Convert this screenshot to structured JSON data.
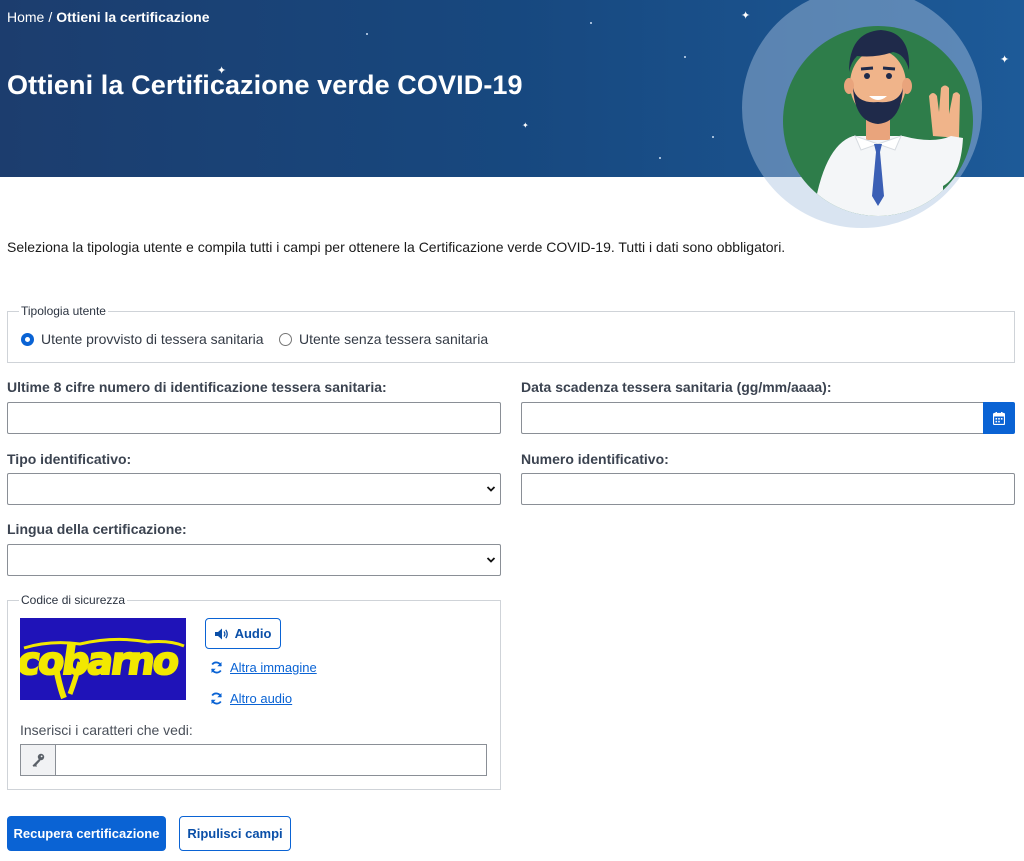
{
  "breadcrumb": {
    "home": "Home",
    "separator": "/",
    "current": "Ottieni la certificazione"
  },
  "page": {
    "title": "Ottieni la Certificazione verde COVID-19",
    "intro": "Seleziona la tipologia utente e compila tutti i campi per ottenere la Certificazione verde COVID-19. Tutti i dati sono obbligatori."
  },
  "user_type": {
    "legend": "Tipologia utente",
    "options": [
      {
        "label": "Utente provvisto di tessera sanitaria",
        "checked": true
      },
      {
        "label": "Utente senza tessera sanitaria",
        "checked": false
      }
    ]
  },
  "fields": {
    "card_digits": {
      "label": "Ultime 8 cifre numero di identificazione tessera sanitaria:",
      "value": ""
    },
    "card_expiry": {
      "label": "Data scadenza tessera sanitaria (gg/mm/aaaa):",
      "value": ""
    },
    "id_type": {
      "label": "Tipo identificativo:",
      "selected": ""
    },
    "id_number": {
      "label": "Numero identificativo:",
      "value": ""
    },
    "language": {
      "label": "Lingua della certificazione:",
      "selected": ""
    }
  },
  "captcha": {
    "legend": "Codice di sicurezza",
    "image_text": "cobarno",
    "audio_label": "Audio",
    "other_image_label": "Altra immagine",
    "other_audio_label": "Altro audio",
    "input_caption": "Inserisci i caratteri che vedi:",
    "value": ""
  },
  "actions": {
    "submit_label": "Recupera certificazione",
    "reset_label": "Ripulisci campi"
  },
  "colors": {
    "primary": "#0a63d4",
    "hero_dark": "#1c3d6e",
    "hero_light": "#1d5a98",
    "avatar_bg": "#2e7d4a",
    "captcha_bg": "#1f13b8",
    "captcha_text": "#f2e800"
  },
  "icons": [
    "calendar-icon",
    "chevron-down-icon",
    "speaker-icon",
    "refresh-icon",
    "key-icon"
  ]
}
